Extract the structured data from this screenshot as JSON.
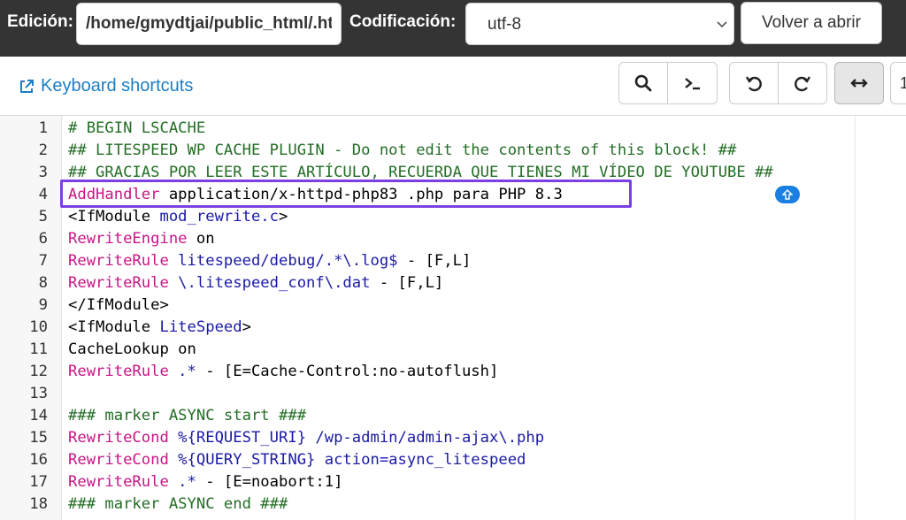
{
  "topbar": {
    "edit_label": "Edición:",
    "path_value": "/home/gmydtjai/public_html/.htaccess",
    "encoding_label": "Codificación:",
    "encoding_value": "utf-8",
    "reopen_label": "Volver a abrir"
  },
  "toolbar": {
    "keyboard_shortcuts": "Keyboard shortcuts",
    "icons": [
      "search-icon",
      "terminal-icon",
      "undo-icon",
      "redo-icon",
      "wrap-icon"
    ],
    "goto_line_value": "1"
  },
  "colors": {
    "comment": "#236e25",
    "keyword": "#c71585",
    "value": "#1a1aa6",
    "highlight_border": "#7b3fe4",
    "link": "#1a7fc4"
  },
  "editor": {
    "lines": [
      {
        "n": "1",
        "parts": [
          {
            "t": "# BEGIN LSCACHE",
            "c": "comment"
          }
        ]
      },
      {
        "n": "2",
        "parts": [
          {
            "t": "## LITESPEED WP CACHE PLUGIN - Do not edit the contents of this block! ##",
            "c": "comment"
          }
        ]
      },
      {
        "n": "3",
        "parts": [
          {
            "t": "## GRACIAS POR LEER ESTE ARTÍCULO, RECUERDA QUE TIENES MI VÍDEO DE YOUTUBE ##",
            "c": "comment"
          }
        ]
      },
      {
        "n": "4",
        "parts": [
          {
            "t": "AddHandler",
            "c": "kw"
          },
          {
            "t": " application/x-httpd-php83 .php para PHP 8.3",
            "c": "plain"
          }
        ]
      },
      {
        "n": "5",
        "parts": [
          {
            "t": "<IfModule ",
            "c": "plain"
          },
          {
            "t": "mod_rewrite.c",
            "c": "str"
          },
          {
            "t": ">",
            "c": "plain"
          }
        ]
      },
      {
        "n": "6",
        "parts": [
          {
            "t": "RewriteEngine",
            "c": "kw"
          },
          {
            "t": " on",
            "c": "plain"
          }
        ]
      },
      {
        "n": "7",
        "parts": [
          {
            "t": "RewriteRule",
            "c": "kw"
          },
          {
            "t": " litespeed/debug/.*\\.log$",
            "c": "str"
          },
          {
            "t": " - [F,L]",
            "c": "plain"
          }
        ]
      },
      {
        "n": "8",
        "parts": [
          {
            "t": "RewriteRule",
            "c": "kw"
          },
          {
            "t": " \\.litespeed_conf\\.dat",
            "c": "str"
          },
          {
            "t": " - [F,L]",
            "c": "plain"
          }
        ]
      },
      {
        "n": "9",
        "parts": [
          {
            "t": "</IfModule>",
            "c": "plain"
          }
        ]
      },
      {
        "n": "10",
        "parts": [
          {
            "t": "<IfModule ",
            "c": "plain"
          },
          {
            "t": "LiteSpeed",
            "c": "str"
          },
          {
            "t": ">",
            "c": "plain"
          }
        ]
      },
      {
        "n": "11",
        "parts": [
          {
            "t": "CacheLookup on",
            "c": "plain"
          }
        ]
      },
      {
        "n": "12",
        "parts": [
          {
            "t": "RewriteRule",
            "c": "kw"
          },
          {
            "t": " .*",
            "c": "str"
          },
          {
            "t": " - [E=Cache-Control:no-autoflush]",
            "c": "plain"
          }
        ]
      },
      {
        "n": "13",
        "parts": []
      },
      {
        "n": "14",
        "parts": [
          {
            "t": "### marker ASYNC start ###",
            "c": "comment"
          }
        ]
      },
      {
        "n": "15",
        "parts": [
          {
            "t": "RewriteCond",
            "c": "kw"
          },
          {
            "t": " %{REQUEST_URI} /wp-admin/admin-ajax\\.php",
            "c": "str"
          }
        ]
      },
      {
        "n": "16",
        "parts": [
          {
            "t": "RewriteCond",
            "c": "kw"
          },
          {
            "t": " %{QUERY_STRING} action=async_litespeed",
            "c": "str"
          }
        ]
      },
      {
        "n": "17",
        "parts": [
          {
            "t": "RewriteRule",
            "c": "kw"
          },
          {
            "t": " .*",
            "c": "str"
          },
          {
            "t": " - [E=noabort:1]",
            "c": "plain"
          }
        ]
      },
      {
        "n": "18",
        "parts": [
          {
            "t": "### marker ASYNC end ###",
            "c": "comment"
          }
        ]
      }
    ]
  }
}
